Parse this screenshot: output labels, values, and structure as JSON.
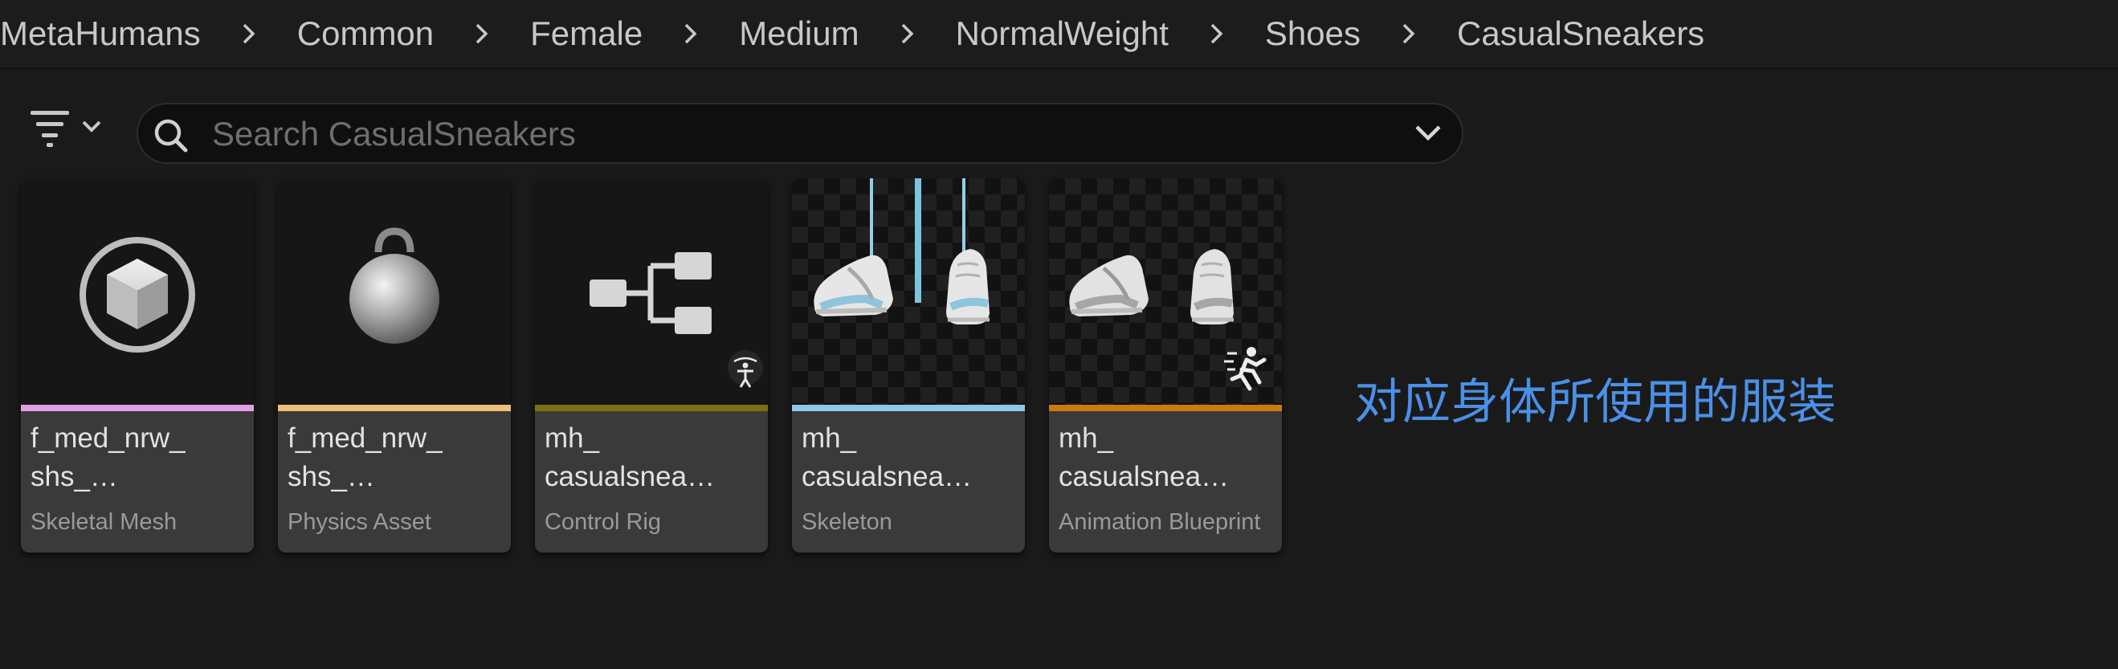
{
  "breadcrumb": {
    "items": [
      "MetaHumans",
      "Common",
      "Female",
      "Medium",
      "NormalWeight",
      "Shoes",
      "CasualSneakers"
    ]
  },
  "search": {
    "placeholder": "Search CasualSneakers",
    "value": ""
  },
  "assets": [
    {
      "name": "f_med_nrw_\nshs_…",
      "type": "Skeletal Mesh",
      "color": "#e0a0e8",
      "icon": "static-mesh-cube-icon"
    },
    {
      "name": "f_med_nrw_\nshs_…",
      "type": "Physics Asset",
      "color": "#f0c078",
      "icon": "physics-asset-ball-icon"
    },
    {
      "name": "mh_\ncasualsnea…",
      "type": "Control Rig",
      "color": "#7a7010",
      "icon": "control-rig-hierarchy-icon"
    },
    {
      "name": "mh_\ncasualsnea…",
      "type": "Skeleton",
      "color": "#8ec8e8",
      "icon": "sneakers-thumbnail"
    },
    {
      "name": "mh_\ncasualsnea…",
      "type": "Animation Blueprint",
      "color": "#d07810",
      "icon": "sneakers-thumbnail"
    }
  ],
  "annotation": "对应身体所使用的服装"
}
